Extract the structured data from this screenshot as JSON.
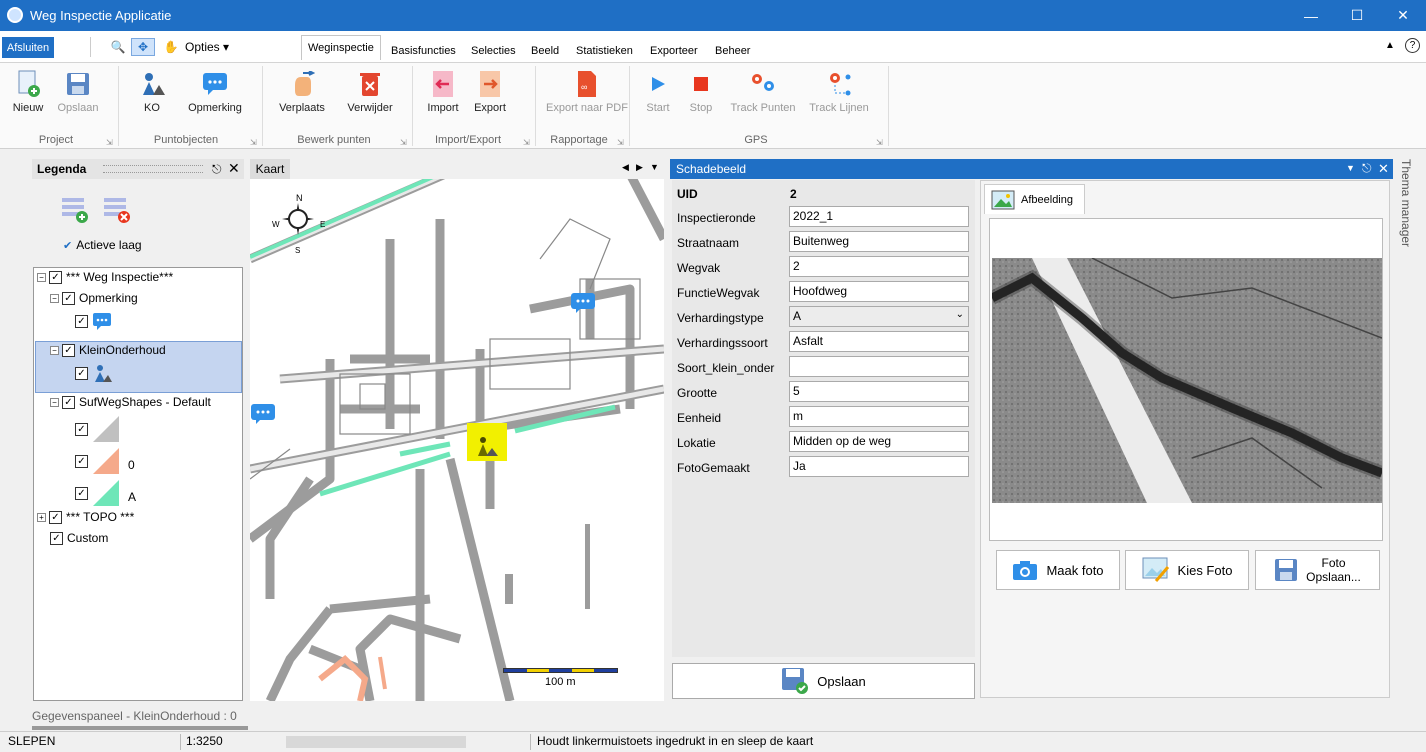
{
  "window": {
    "title": "Weg Inspectie Applicatie"
  },
  "quickaccess": {
    "afsluiten": "Afsluiten",
    "opties": "Opties"
  },
  "tabs": [
    "Weginspectie",
    "Basisfuncties",
    "Selecties",
    "Beeld",
    "Statistieken",
    "Exporteer",
    "Beheer"
  ],
  "ribbon": {
    "nieuw": "Nieuw",
    "opslaan": "Opslaan",
    "ko": "KO",
    "opmerking": "Opmerking",
    "verplaats": "Verplaats",
    "verwijder": "Verwijder",
    "import": "Import",
    "export": "Export",
    "export_pdf": "Export naar PDF",
    "start": "Start",
    "stop": "Stop",
    "track_punten": "Track Punten",
    "track_lijnen": "Track Lijnen",
    "groups": {
      "project": "Project",
      "puntobjecten": "Puntobjecten",
      "bewerk": "Bewerk punten",
      "importexport": "Import/Export",
      "rapportage": "Rapportage",
      "gps": "GPS"
    }
  },
  "legend": {
    "title": "Legenda",
    "actieve_laag": "Actieve laag",
    "items": {
      "weg": "*** Weg Inspectie***",
      "opmerking": "Opmerking",
      "kleinonderhoud": "KleinOnderhoud",
      "sufweg": "SufWegShapes - Default",
      "sym0": "0",
      "symA": "A",
      "topo": "*** TOPO ***",
      "custom": "Custom"
    }
  },
  "map": {
    "tab": "Kaart",
    "scale_label": "100 m",
    "compass": {
      "n": "N",
      "e": "E",
      "s": "S",
      "w": "W"
    }
  },
  "schade": {
    "title": "Schadebeeld",
    "uid_label": "UID",
    "uid_value": "2",
    "fields": [
      {
        "label": "Inspectieronde",
        "value": "2022_1"
      },
      {
        "label": "Straatnaam",
        "value": "Buitenweg"
      },
      {
        "label": "Wegvak",
        "value": "2"
      },
      {
        "label": "FunctieWegvak",
        "value": "Hoofdweg"
      },
      {
        "label": "Verhardingstype",
        "value": "A"
      },
      {
        "label": "Verhardingssoort",
        "value": "Asfalt"
      },
      {
        "label": "Soort_klein_onder",
        "value": ""
      },
      {
        "label": "Grootte",
        "value": "5"
      },
      {
        "label": "Eenheid",
        "value": "m"
      },
      {
        "label": "Lokatie",
        "value": "Midden op de weg"
      },
      {
        "label": "FotoGemaakt",
        "value": "Ja"
      }
    ],
    "opslaan": "Opslaan",
    "afbeelding_tab": "Afbeelding",
    "maak_foto": "Maak foto",
    "kies_foto": "Kies Foto",
    "foto_opslaan_1": "Foto",
    "foto_opslaan_2": "Opslaan..."
  },
  "thema": "Thema manager",
  "gegevenspaneel": "Gegevenspaneel - KleinOnderhoud : 0",
  "status": {
    "mode": "SLEPEN",
    "scale": "1:3250",
    "hint": "Houdt linkermuistoets ingedrukt in en sleep de kaart"
  },
  "colors": {
    "accent": "#1f6fc5",
    "selection": "#c5d5f0",
    "road_green": "#6ee6b8",
    "marker": "#f2f000"
  }
}
